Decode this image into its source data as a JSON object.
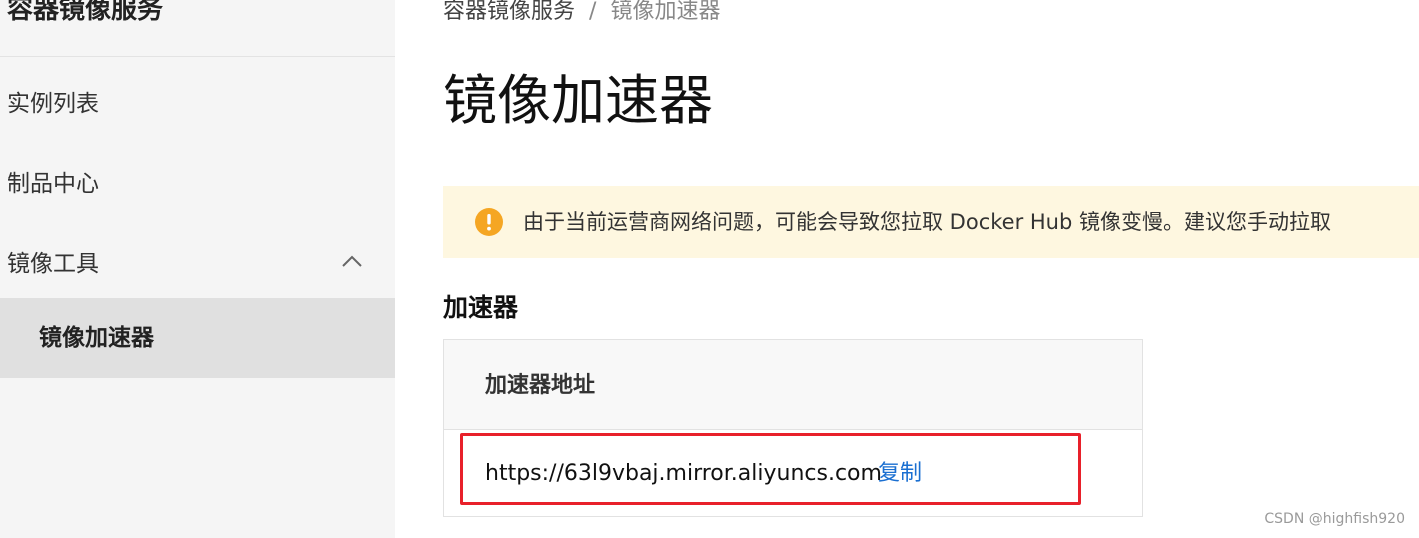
{
  "sidebar": {
    "title": "容器镜像服务",
    "items": [
      {
        "label": "实例列表"
      },
      {
        "label": "制品中心"
      },
      {
        "label": "镜像工具",
        "expanded": true
      },
      {
        "label": "镜像加速器",
        "active": true
      }
    ]
  },
  "breadcrumb": {
    "parent": "容器镜像服务",
    "separator": "/",
    "current": "镜像加速器"
  },
  "page": {
    "title": "镜像加速器"
  },
  "notice": {
    "icon": "warning-icon",
    "color": "#f5a623",
    "text": "由于当前运营商网络问题，可能会导致您拉取 Docker Hub 镜像变慢。建议您手动拉取"
  },
  "accelerator": {
    "section_title": "加速器",
    "header_label": "加速器地址",
    "url": "https://63l9vbaj.mirror.aliyuncs.com",
    "copy_label": "复制"
  },
  "watermark": "CSDN @highfish920",
  "colors": {
    "highlight": "#e8202a",
    "link": "#1a6fd1",
    "notice_bg": "#fef7e0",
    "sidebar_bg": "#f5f5f5",
    "active_bg": "#e0e0e0"
  }
}
